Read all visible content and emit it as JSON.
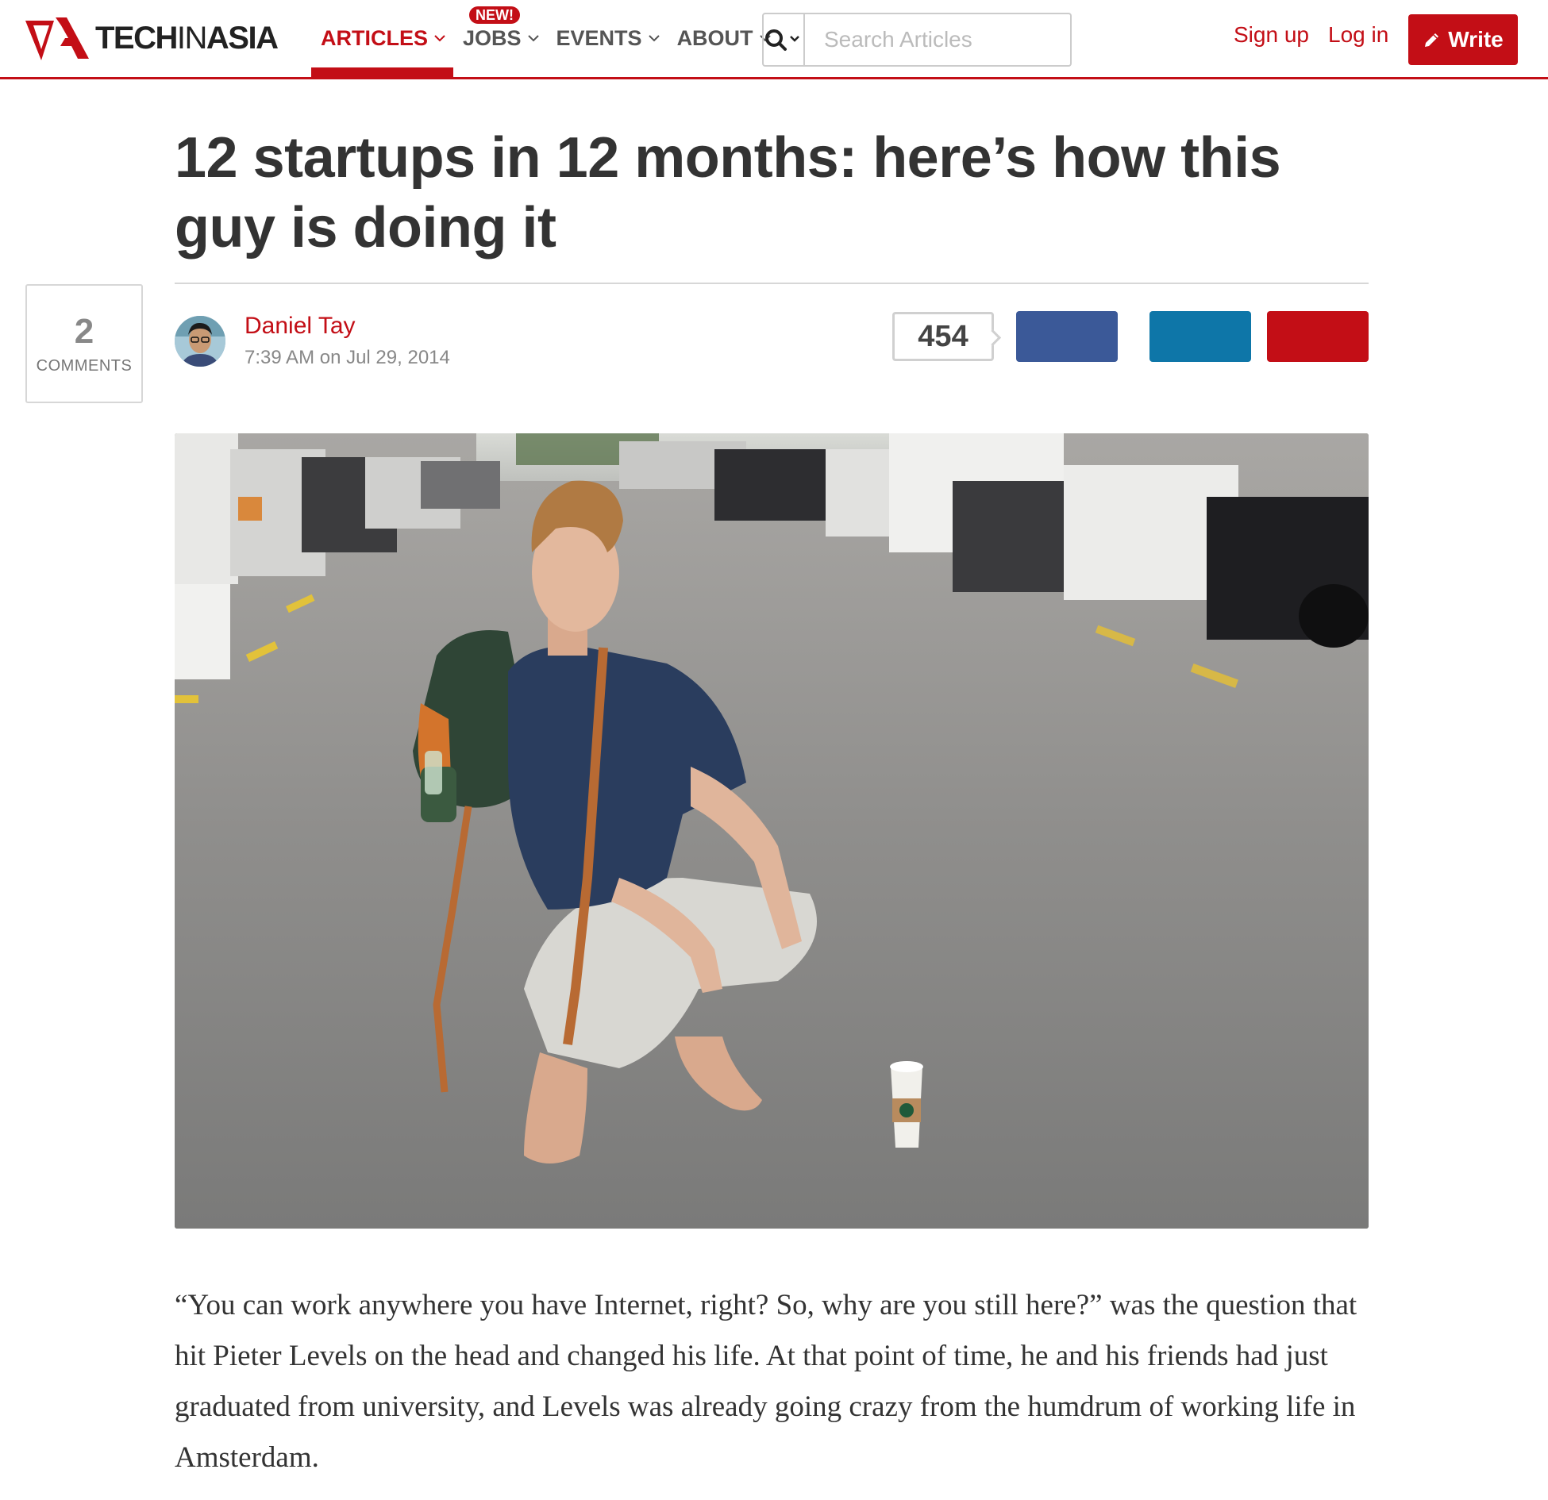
{
  "header": {
    "logo_text_bold": "TECH",
    "logo_text_thin": "IN",
    "logo_text_end": "ASIA",
    "nav": [
      {
        "label": "ARTICLES",
        "active": true
      },
      {
        "label": "JOBS",
        "badge": "NEW!"
      },
      {
        "label": "EVENTS"
      },
      {
        "label": "ABOUT"
      }
    ],
    "search_placeholder": "Search Articles",
    "search_icon": "search-icon",
    "signup_label": "Sign up",
    "login_label": "Log in",
    "write_label": "Write",
    "write_icon": "pencil-icon"
  },
  "article": {
    "title": "12 startups in 12 months: here’s how this guy is doing it",
    "comments_count": "2",
    "comments_label": "COMMENTS",
    "author": "Daniel Tay",
    "date": "7:39 AM on Jul 29, 2014",
    "share_count": "454",
    "share_buttons": [
      {
        "network": "facebook",
        "color": "#3b5998"
      },
      {
        "network": "linkedin",
        "color": "#0e76a8"
      },
      {
        "network": "google-plus",
        "color": "#c30e16"
      }
    ],
    "hero_image": "man-crouching-on-street-with-backpack",
    "lead_paragraph": "“You can work anywhere you have Internet, right? So, why are you still here?” was the question that hit Pieter Levels on the head and changed his life. At that point of time, he and his friends had just graduated from university, and Levels was already going crazy from the humdrum of working life in Amsterdam."
  },
  "colors": {
    "brand_red": "#c30e16",
    "text_dark": "#333333",
    "text_muted": "#888888"
  }
}
